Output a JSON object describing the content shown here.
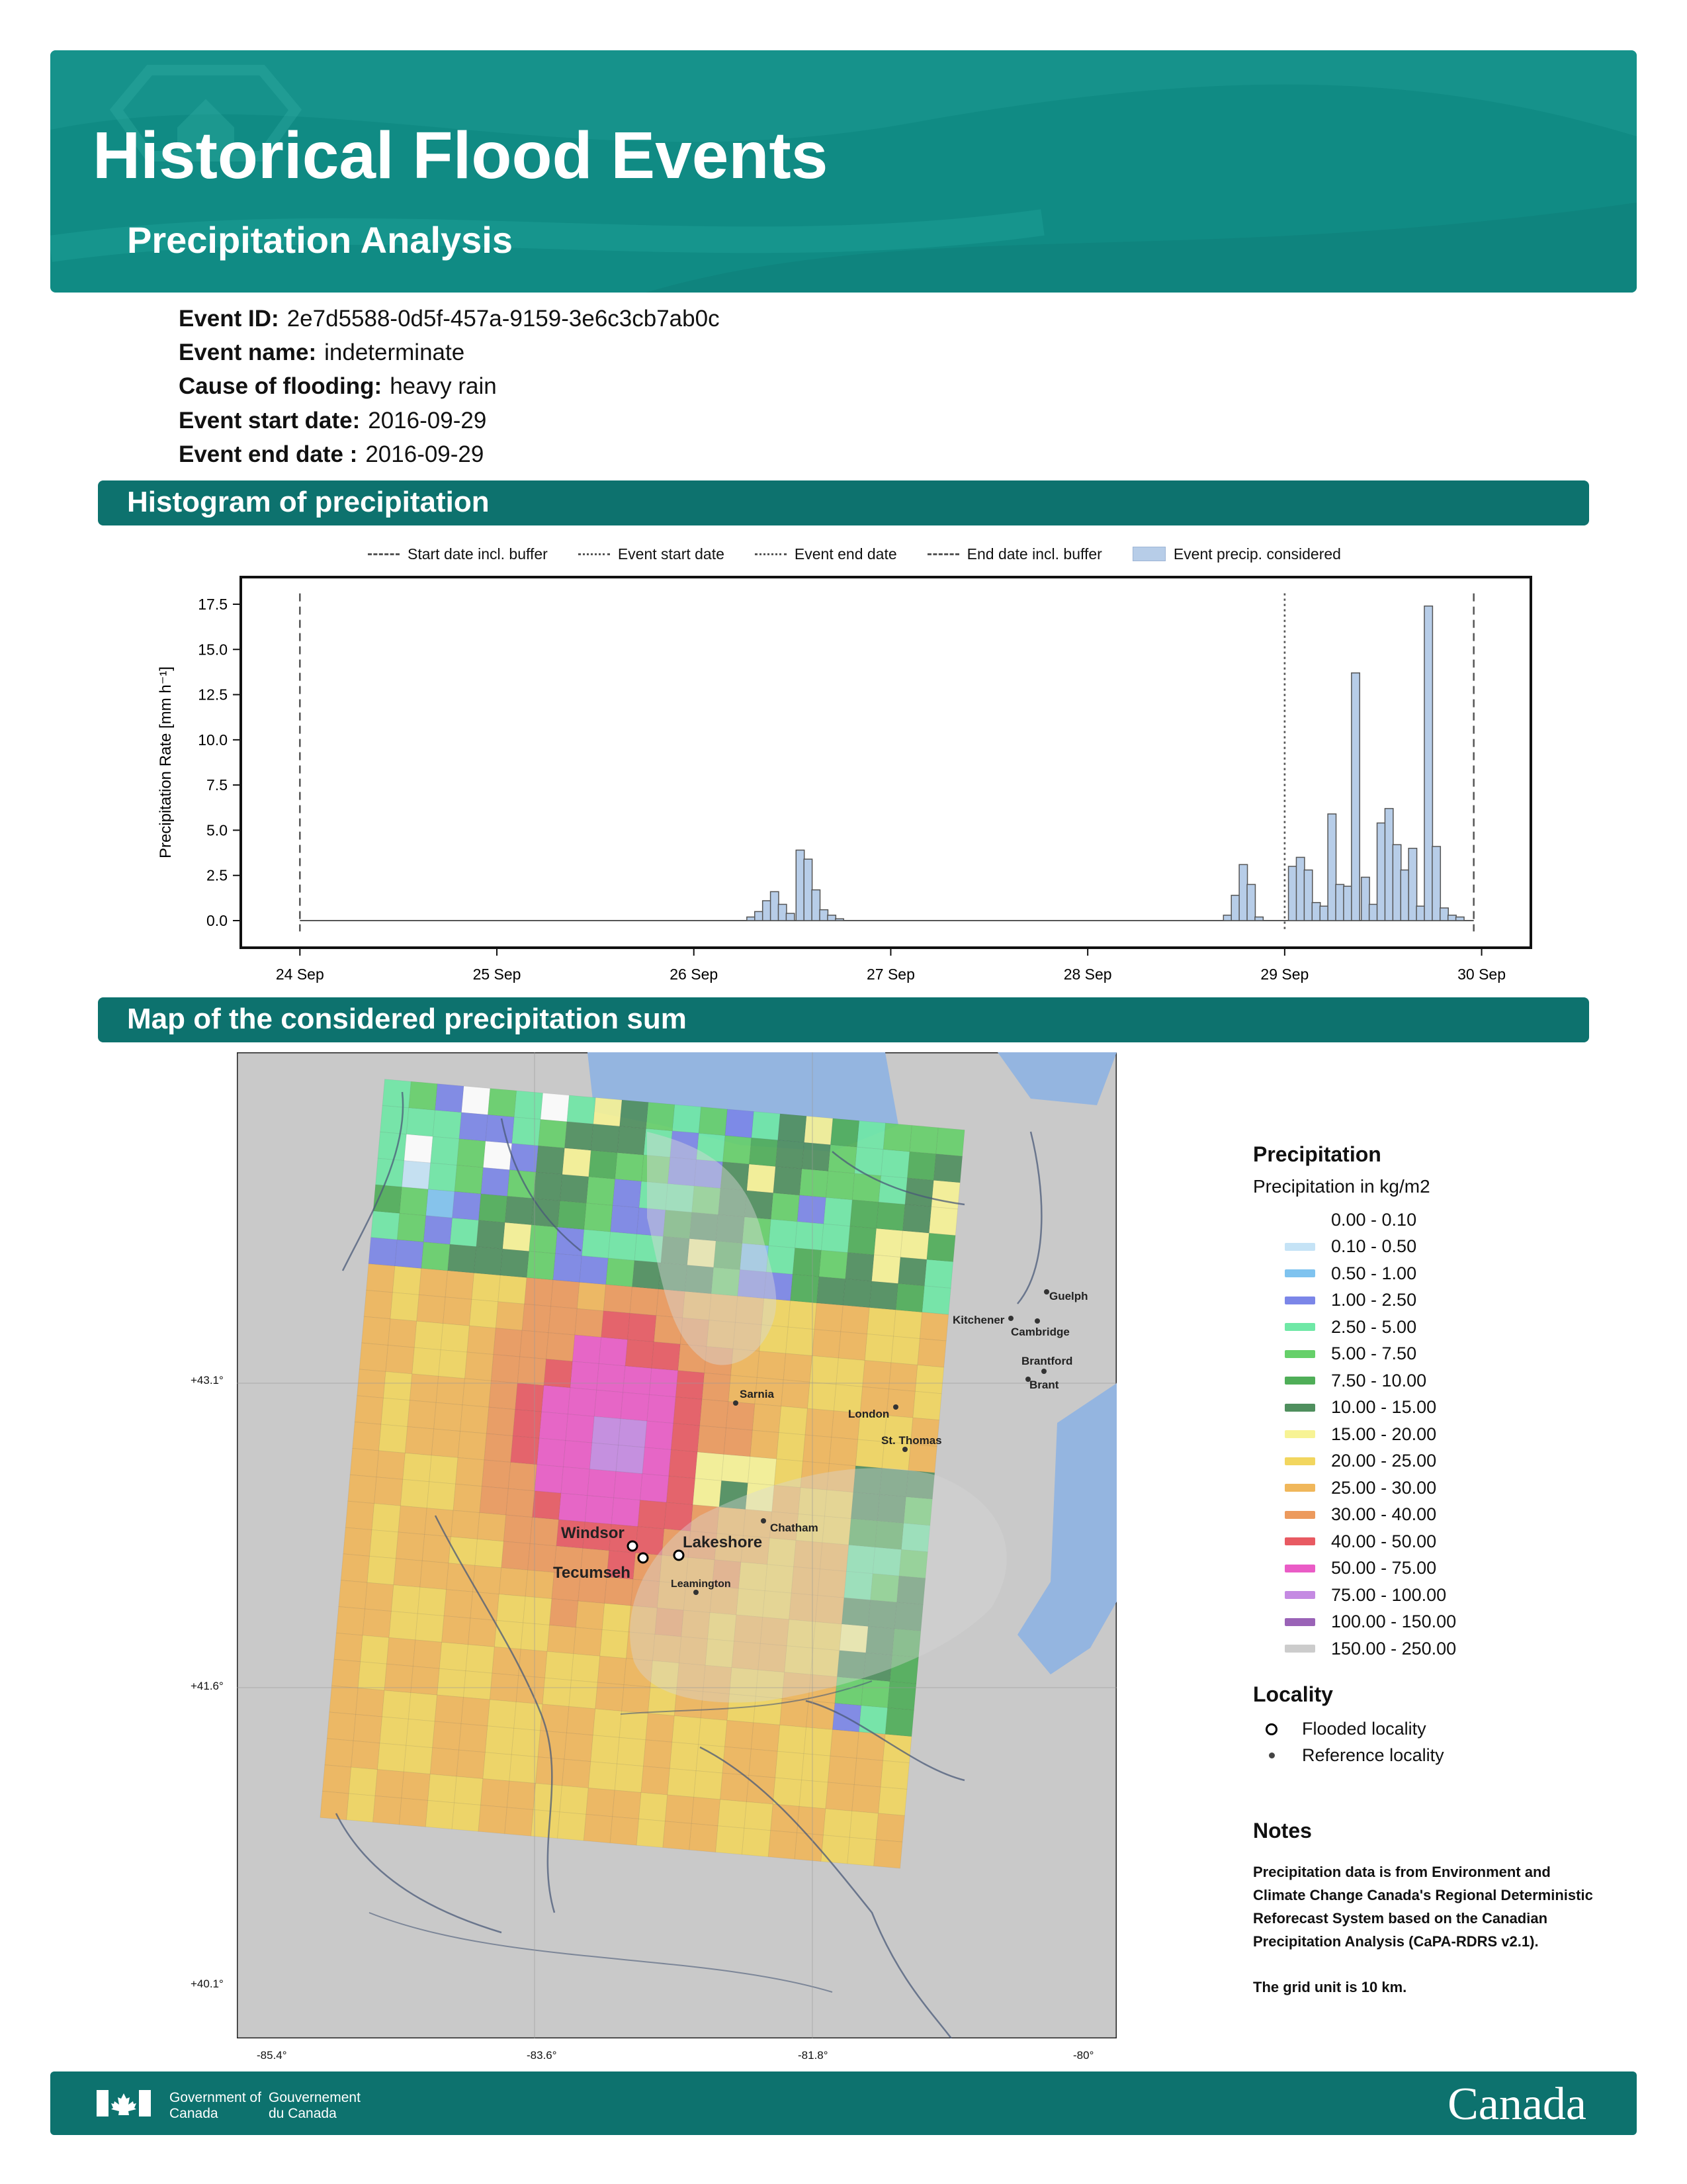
{
  "header": {
    "title": "Historical Flood Events",
    "subtitle": "Precipitation Analysis"
  },
  "event": {
    "id_label": "Event ID:",
    "id_value": "2e7d5588-0d5f-457a-9159-3e6c3cb7ab0c",
    "name_label": "Event name:",
    "name_value": "indeterminate",
    "cause_label": "Cause of flooding:",
    "cause_value": "heavy rain",
    "start_label": "Event start date:",
    "start_value": "2016-09-29",
    "end_label": "Event end date :",
    "end_value": "2016-09-29"
  },
  "sections": {
    "histogram": "Histogram of precipitation",
    "map": "Map of the considered precipitation sum"
  },
  "chart_data": {
    "type": "bar",
    "ylabel": "Precipitation Rate [mm h⁻¹]",
    "ylim": [
      -1.5,
      19
    ],
    "yticks": [
      "0.0",
      "2.5",
      "5.0",
      "7.5",
      "10.0",
      "12.5",
      "15.0",
      "17.5"
    ],
    "ytick_values": [
      0,
      2.5,
      5,
      7.5,
      10,
      12.5,
      15,
      17.5
    ],
    "xlim": [
      -0.3,
      6.25
    ],
    "xticks": [
      "24 Sep",
      "25 Sep",
      "26 Sep",
      "27 Sep",
      "28 Sep",
      "29 Sep",
      "30 Sep"
    ],
    "xtick_values": [
      0,
      1,
      2,
      3,
      4,
      5,
      6
    ],
    "legend": {
      "start_buffer": "Start date incl. buffer",
      "event_start": "Event start date",
      "event_end": "Event end date",
      "end_buffer": "End date incl. buffer",
      "event_precip": "Event precip. considered"
    },
    "vlines": {
      "start_buffer": 0,
      "event_start": 5.0,
      "event_end": 5.0,
      "end_buffer": 5.96
    },
    "bars": [
      {
        "x": 2.29,
        "v": 0.2
      },
      {
        "x": 2.33,
        "v": 0.5
      },
      {
        "x": 2.37,
        "v": 1.1
      },
      {
        "x": 2.41,
        "v": 1.6
      },
      {
        "x": 2.45,
        "v": 0.9
      },
      {
        "x": 2.49,
        "v": 0.4
      },
      {
        "x": 2.54,
        "v": 3.9
      },
      {
        "x": 2.58,
        "v": 3.4
      },
      {
        "x": 2.62,
        "v": 1.7
      },
      {
        "x": 2.66,
        "v": 0.6
      },
      {
        "x": 2.7,
        "v": 0.3
      },
      {
        "x": 2.74,
        "v": 0.1
      },
      {
        "x": 4.71,
        "v": 0.3
      },
      {
        "x": 4.75,
        "v": 1.4
      },
      {
        "x": 4.79,
        "v": 3.1
      },
      {
        "x": 4.83,
        "v": 2.0
      },
      {
        "x": 4.87,
        "v": 0.2
      },
      {
        "x": 5.04,
        "v": 3.0
      },
      {
        "x": 5.08,
        "v": 3.5
      },
      {
        "x": 5.12,
        "v": 2.8
      },
      {
        "x": 5.16,
        "v": 1.0
      },
      {
        "x": 5.2,
        "v": 0.8
      },
      {
        "x": 5.24,
        "v": 5.9
      },
      {
        "x": 5.28,
        "v": 2.0
      },
      {
        "x": 5.32,
        "v": 1.9
      },
      {
        "x": 5.36,
        "v": 13.7
      },
      {
        "x": 5.41,
        "v": 2.4
      },
      {
        "x": 5.45,
        "v": 0.9
      },
      {
        "x": 5.49,
        "v": 5.4
      },
      {
        "x": 5.53,
        "v": 6.2
      },
      {
        "x": 5.57,
        "v": 4.2
      },
      {
        "x": 5.61,
        "v": 2.8
      },
      {
        "x": 5.65,
        "v": 4.0
      },
      {
        "x": 5.69,
        "v": 0.8
      },
      {
        "x": 5.73,
        "v": 17.4
      },
      {
        "x": 5.77,
        "v": 4.1
      },
      {
        "x": 5.81,
        "v": 0.7
      },
      {
        "x": 5.85,
        "v": 0.3
      },
      {
        "x": 5.89,
        "v": 0.2
      }
    ]
  },
  "map": {
    "lat_labels": [
      "+43.1°",
      "+41.6°",
      "+40.1°"
    ],
    "lon_labels": [
      "-85.4°",
      "-83.6°",
      "-81.8°",
      "-80°"
    ],
    "localities": {
      "windsor": "Windsor",
      "lakeshore": "Lakeshore",
      "tecumseh": "Tecumseh",
      "leamington": "Leamington",
      "chatham": "Chatham",
      "sarnia": "Sarnia",
      "london": "London",
      "st_thomas": "St. Thomas",
      "kitchener": "Kitchener",
      "cambridge": "Cambridge",
      "guelph": "Guelph",
      "brantford": "Brantford",
      "brant": "Brant"
    }
  },
  "map_legend": {
    "title": "Precipitation",
    "subtitle": "Precipitation in kg/m2",
    "bins": [
      {
        "label": "0.00 - 0.10",
        "color": "#ffffff"
      },
      {
        "label": "0.10 - 0.50",
        "color": "#c5e3f6"
      },
      {
        "label": "0.50 - 1.00",
        "color": "#7fc3ef"
      },
      {
        "label": "1.00 - 2.50",
        "color": "#7b86e8"
      },
      {
        "label": "2.50 - 5.00",
        "color": "#6fe8a6"
      },
      {
        "label": "5.00 - 7.50",
        "color": "#66d06a"
      },
      {
        "label": "7.50 - 10.00",
        "color": "#4fae58"
      },
      {
        "label": "10.00 - 15.00",
        "color": "#4f8f5e"
      },
      {
        "label": "15.00 - 20.00",
        "color": "#f7f395"
      },
      {
        "label": "20.00 - 25.00",
        "color": "#f2d65f"
      },
      {
        "label": "25.00 - 30.00",
        "color": "#f0b75b"
      },
      {
        "label": "30.00 - 40.00",
        "color": "#ec9a5d"
      },
      {
        "label": "40.00 - 50.00",
        "color": "#e85a62"
      },
      {
        "label": "50.00 - 75.00",
        "color": "#ea5cc6"
      },
      {
        "label": "75.00 - 100.00",
        "color": "#c58ae2"
      },
      {
        "label": "100.00 - 150.00",
        "color": "#9a63b7"
      },
      {
        "label": "150.00 - 250.00",
        "color": "#cccccc"
      }
    ],
    "locality_title": "Locality",
    "flooded": "Flooded locality",
    "reference": "Reference locality"
  },
  "notes": {
    "title": "Notes",
    "text1": "Precipitation data is from Environment and Climate Change Canada's Regional Deterministic Reforecast System based on the Canadian Precipitation Analysis (CaPA-RDRS v2.1).",
    "text2": "The grid unit is 10 km."
  },
  "footer": {
    "gov_en": "Government of Canada",
    "gov_fr": "Gouvernement du Canada",
    "wordmark": "Canada"
  },
  "colors": {
    "banner": "#108b84",
    "section": "#0d726e",
    "bar_fill": "#b7cde8",
    "bar_edge": "#555555"
  }
}
